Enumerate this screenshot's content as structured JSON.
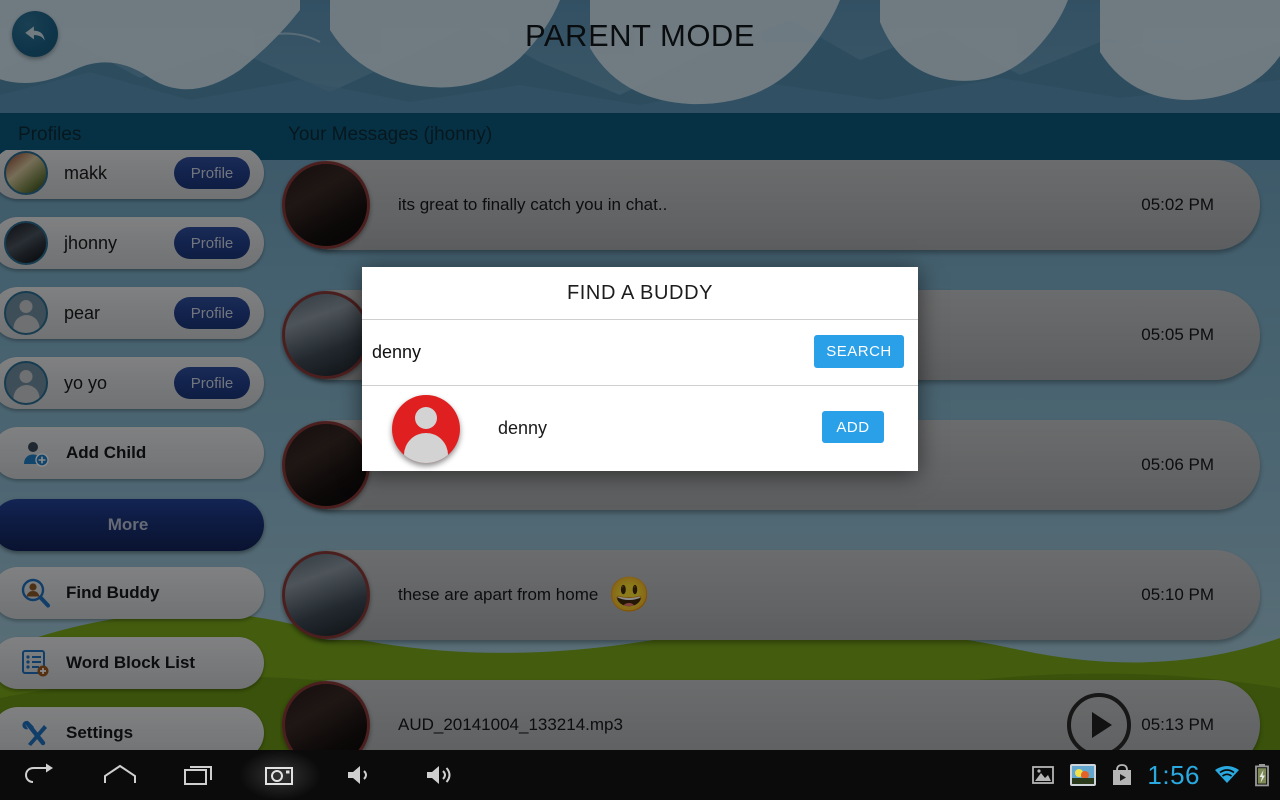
{
  "header": {
    "title": "PARENT MODE",
    "back_icon": "back-arrow-icon"
  },
  "section_bar": {
    "profiles_label": "Profiles",
    "messages_label": "Your Messages (jhonny)"
  },
  "sidebar": {
    "profiles": [
      {
        "name": "makk",
        "button_label": "Profile",
        "avatar": "photo-avatar"
      },
      {
        "name": "jhonny",
        "button_label": "Profile",
        "avatar": "photo-avatar"
      },
      {
        "name": "pear",
        "button_label": "Profile",
        "avatar": "default-person-avatar"
      },
      {
        "name": "yo yo",
        "button_label": "Profile",
        "avatar": "default-person-avatar"
      }
    ],
    "add_child": {
      "label": "Add Child",
      "icon": "add-child-icon"
    },
    "more": {
      "label": "More"
    },
    "menu": [
      {
        "label": "Find Buddy",
        "icon": "find-buddy-icon"
      },
      {
        "label": "Word Block List",
        "icon": "word-block-list-icon"
      },
      {
        "label": "Settings",
        "icon": "settings-wrench-icon"
      }
    ]
  },
  "messages": [
    {
      "text": "its great to finally catch you in chat..",
      "time": "05:02 PM",
      "avatar": "dark-photo-avatar",
      "type": "text"
    },
    {
      "text": "",
      "time": "05:05 PM",
      "avatar": "person-photo-avatar",
      "type": "text"
    },
    {
      "text": "",
      "time": "05:06 PM",
      "avatar": "dark-photo-avatar",
      "type": "text"
    },
    {
      "text": "these are apart from home",
      "emoji": "😃",
      "time": "05:10 PM",
      "avatar": "person-photo-avatar",
      "type": "emoji"
    },
    {
      "text": "AUD_20141004_133214.mp3",
      "time": "05:13 PM",
      "avatar": "dark-photo-avatar",
      "type": "audio",
      "play_icon": "play-icon"
    }
  ],
  "dialog": {
    "title": "FIND A BUDDY",
    "search_value": "denny",
    "search_placeholder": "",
    "search_button": "SEARCH",
    "result": {
      "name": "denny",
      "add_button": "ADD",
      "avatar": "red-default-person-avatar"
    }
  },
  "navbar": {
    "back_icon": "back-icon",
    "home_icon": "home-icon",
    "recents_icon": "recent-apps-icon",
    "screenshot_icon": "camera-screenshot-icon",
    "volume_down_icon": "volume-down-icon",
    "volume_up_icon": "volume-up-icon",
    "status": {
      "image_icon": "image-icon",
      "gallery_icon": "gallery-icon",
      "play_store_icon": "play-store-icon",
      "time": "1:56",
      "wifi_icon": "wifi-icon",
      "battery_icon": "battery-charging-icon"
    }
  },
  "colors": {
    "accent_blue": "#2aa0e8",
    "header_bar": "#0b5a7d",
    "profile_pill": "#22408c",
    "clock_blue": "#2aa8e0",
    "result_avatar_red": "#e02020"
  }
}
